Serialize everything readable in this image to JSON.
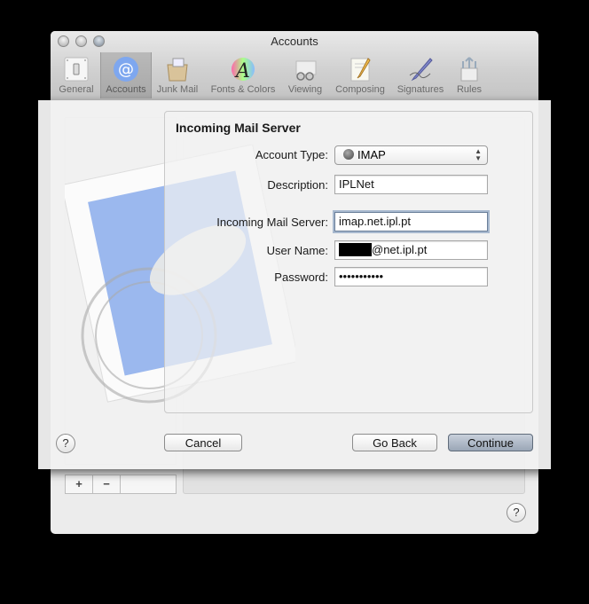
{
  "window": {
    "title": "Accounts"
  },
  "toolbar": {
    "items": [
      {
        "label": "General",
        "icon": "general-switch-icon"
      },
      {
        "label": "Accounts",
        "icon": "at-sign-icon",
        "selected": true
      },
      {
        "label": "Junk Mail",
        "icon": "junk-mail-bag-icon"
      },
      {
        "label": "Fonts & Colors",
        "icon": "fonts-colors-icon"
      },
      {
        "label": "Viewing",
        "icon": "viewing-glasses-icon"
      },
      {
        "label": "Composing",
        "icon": "composing-pencil-icon"
      },
      {
        "label": "Signatures",
        "icon": "signatures-pen-icon"
      },
      {
        "label": "Rules",
        "icon": "rules-arrows-icon"
      }
    ]
  },
  "background": {
    "add_label": "+",
    "remove_label": "−",
    "help_label": "?"
  },
  "sheet": {
    "title": "Incoming Mail Server",
    "account_type": {
      "label": "Account Type:",
      "value": "IMAP"
    },
    "description": {
      "label": "Description:",
      "value": "IPLNet"
    },
    "incoming_server": {
      "label": "Incoming Mail Server:",
      "value": "imap.net.ipl.pt"
    },
    "user_name": {
      "label": "User Name:",
      "value_suffix": "@net.ipl.pt"
    },
    "password": {
      "label": "Password:",
      "value": "•••••••••••"
    },
    "buttons": {
      "help": "?",
      "cancel": "Cancel",
      "go_back": "Go Back",
      "continue": "Continue"
    }
  }
}
